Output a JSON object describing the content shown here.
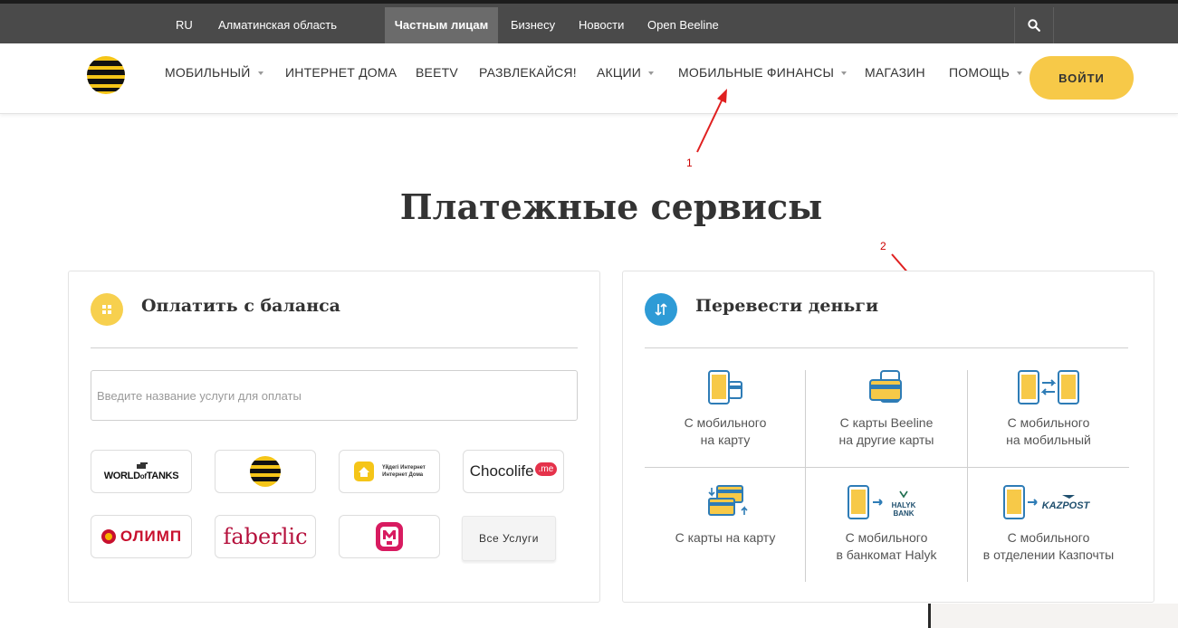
{
  "topbar": {
    "lang": "RU",
    "region": "Алматинская область",
    "items": [
      "Частным лицам",
      "Бизнесу",
      "Новости",
      "Open Beeline"
    ],
    "search_icon": "search-icon"
  },
  "nav": {
    "items": [
      "МОБИЛЬНЫЙ",
      "ИНТЕРНЕТ ДОМА",
      "BEETV",
      "РАЗВЛЕКАЙСЯ!",
      "АКЦИИ",
      "МОБИЛЬНЫЕ ФИНАНСЫ",
      "МАГАЗИН",
      "ПОМОЩЬ"
    ],
    "login": "ВОЙТИ"
  },
  "annotations": [
    "1",
    "2"
  ],
  "page_title": "Платежные сервисы",
  "pay": {
    "title": "Оплатить с баланса",
    "search_placeholder": "Введите название услуги для оплаты",
    "partners": [
      {
        "name": "WORLD of TANKS",
        "text1": "WORLD",
        "text2": "of",
        "text3": "TANKS"
      },
      {
        "name": "Beeline"
      },
      {
        "name": "Үйдегі Интернет Интернет Дома",
        "line1": "Үйдегі Интернет",
        "line2": "Интернет Дома"
      },
      {
        "name": "Chocolife.me",
        "text": "Chocolife",
        "suffix": ".me"
      },
      {
        "name": "ОЛИМП",
        "text": "ОЛИМП"
      },
      {
        "name": "faberlic",
        "text": "faberlic"
      },
      {
        "name": "MU"
      }
    ],
    "all_services": "Все Услуги"
  },
  "transfer": {
    "title": "Перевести деньги",
    "cells": [
      {
        "line1": "С мобильного",
        "line2": "на карту"
      },
      {
        "line1": "С карты Beeline",
        "line2": "на другие карты"
      },
      {
        "line1": "С мобильного",
        "line2": "на мобильный"
      },
      {
        "line1": "С карты на карту",
        "line2": ""
      },
      {
        "line1": "С мобильного",
        "line2": "в банкомат Halyk",
        "logo": "HALYK BANK"
      },
      {
        "line1": "С мобильного",
        "line2": "в отделении Казпочты",
        "logo": "KAZPOST"
      }
    ]
  },
  "colors": {
    "accent": "#f7c948",
    "blue": "#2e9bd6",
    "dark": "#4a4a4a"
  }
}
